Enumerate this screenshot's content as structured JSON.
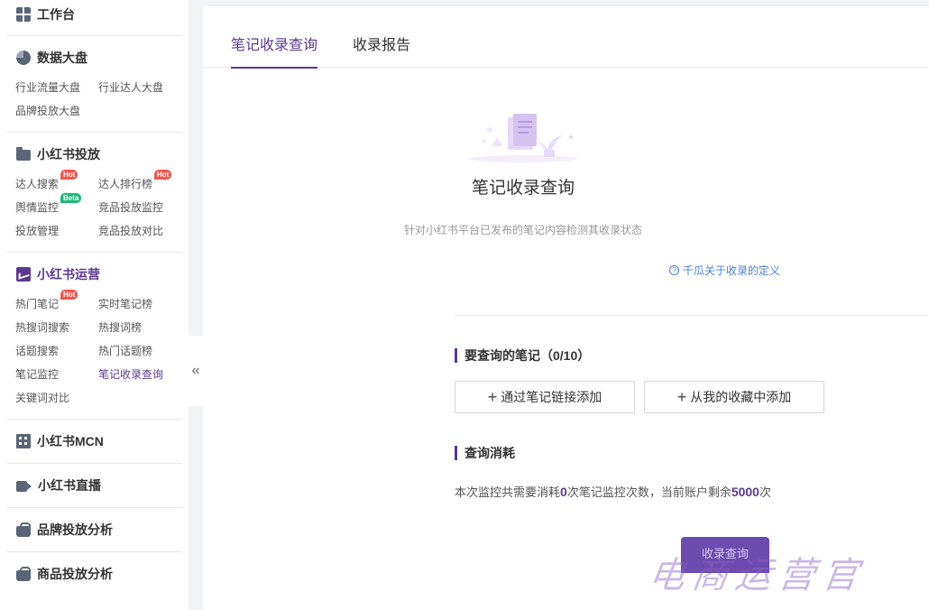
{
  "sidebar": {
    "sections": [
      {
        "id": "workbench",
        "title": "工作台",
        "icon": "grid-icon",
        "items": []
      },
      {
        "id": "bigdata",
        "title": "数据大盘",
        "icon": "pie-chart-icon",
        "items": [
          {
            "label": "行业流量大盘"
          },
          {
            "label": "行业达人大盘"
          },
          {
            "label": "品牌投放大盘"
          }
        ]
      },
      {
        "id": "ad",
        "title": "小红书投放",
        "icon": "folder-icon",
        "items": [
          {
            "label": "达人搜索",
            "badge": "Hot"
          },
          {
            "label": "达人排行榜",
            "badge": "Hot"
          },
          {
            "label": "舆情监控",
            "badge": "Beta"
          },
          {
            "label": "竞品投放监控"
          },
          {
            "label": "投放管理"
          },
          {
            "label": "竞品投放对比"
          }
        ]
      },
      {
        "id": "ops",
        "title": "小红书运营",
        "icon": "trend-chart-icon",
        "items": [
          {
            "label": "热门笔记",
            "badge": "Hot"
          },
          {
            "label": "实时笔记榜"
          },
          {
            "label": "热搜词搜索"
          },
          {
            "label": "热搜词榜"
          },
          {
            "label": "话题搜索"
          },
          {
            "label": "热门话题榜"
          },
          {
            "label": "笔记监控"
          },
          {
            "label": "笔记收录查询"
          },
          {
            "label": "关键词对比"
          }
        ]
      },
      {
        "id": "mcn",
        "title": "小红书MCN",
        "icon": "building-icon",
        "items": []
      },
      {
        "id": "live",
        "title": "小红书直播",
        "icon": "video-icon",
        "items": []
      },
      {
        "id": "brand",
        "title": "品牌投放分析",
        "icon": "shopping-bag-icon",
        "items": []
      },
      {
        "id": "goods",
        "title": "商品投放分析",
        "icon": "bag-icon",
        "items": []
      }
    ],
    "collapse_glyph": "«"
  },
  "tabs": [
    {
      "label": "笔记收录查询"
    },
    {
      "label": "收录报告"
    }
  ],
  "hero": {
    "title": "笔记收录查询",
    "description": "针对小红书平台已发布的笔记内容检测其收录状态",
    "help_link": "千瓜关于收录的定义",
    "help_glyph": "?"
  },
  "query": {
    "section_title": "要查询的笔记（0/10）",
    "add_by_link": "通过笔记链接添加",
    "add_from_favorites": "从我的收藏中添加",
    "plus_glyph": "+"
  },
  "cost": {
    "section_title": "查询消耗",
    "prefix": "本次监控共需要消耗",
    "count": "0",
    "middle": "次笔记监控次数，当前账户剩余",
    "remaining": "5000",
    "suffix": "次"
  },
  "submit_button": "收录查询",
  "watermark": "电商运营官",
  "colors": {
    "accent": "#5b3a8e",
    "hot_badge": "#f0564d",
    "beta_badge": "#1fb87a",
    "link": "#4c7fd4"
  }
}
